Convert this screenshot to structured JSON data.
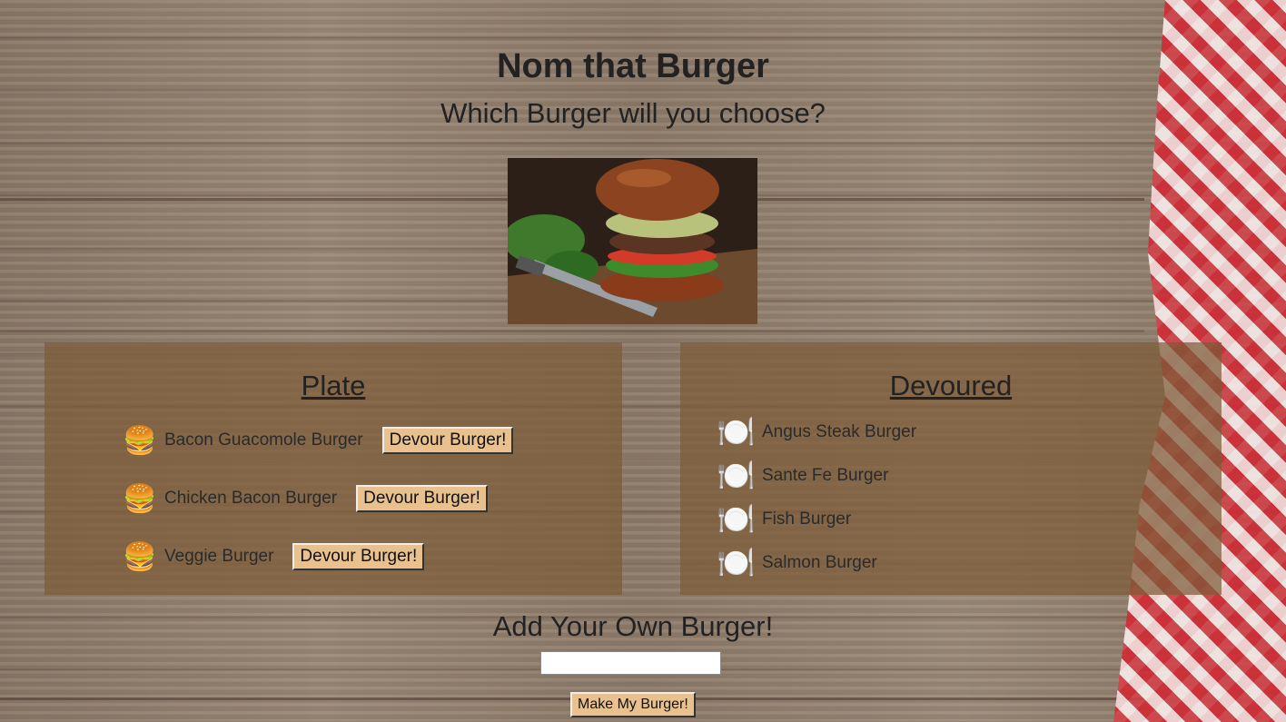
{
  "header": {
    "title": "Nom that Burger",
    "subtitle": "Which Burger will you choose?"
  },
  "hero_image": {
    "description_icon": "burger-photo"
  },
  "plate": {
    "title": "Plate",
    "button_label": "Devour Burger!",
    "items": [
      {
        "name": "Bacon Guacomole Burger",
        "icon": "🍔"
      },
      {
        "name": "Chicken Bacon Burger",
        "icon": "🍔"
      },
      {
        "name": "Veggie Burger",
        "icon": "🍔"
      }
    ]
  },
  "devoured": {
    "title": "Devoured",
    "items": [
      {
        "name": "Angus Steak Burger",
        "icon": "🍽️"
      },
      {
        "name": "Sante Fe Burger",
        "icon": "🍽️"
      },
      {
        "name": "Fish Burger",
        "icon": "🍽️"
      },
      {
        "name": "Salmon Burger",
        "icon": "🍽️"
      }
    ]
  },
  "add_form": {
    "title": "Add Your Own Burger!",
    "input_value": "",
    "submit_label": "Make My Burger!"
  },
  "colors": {
    "panel": "#7d5c37",
    "button": "#e8c18f"
  }
}
